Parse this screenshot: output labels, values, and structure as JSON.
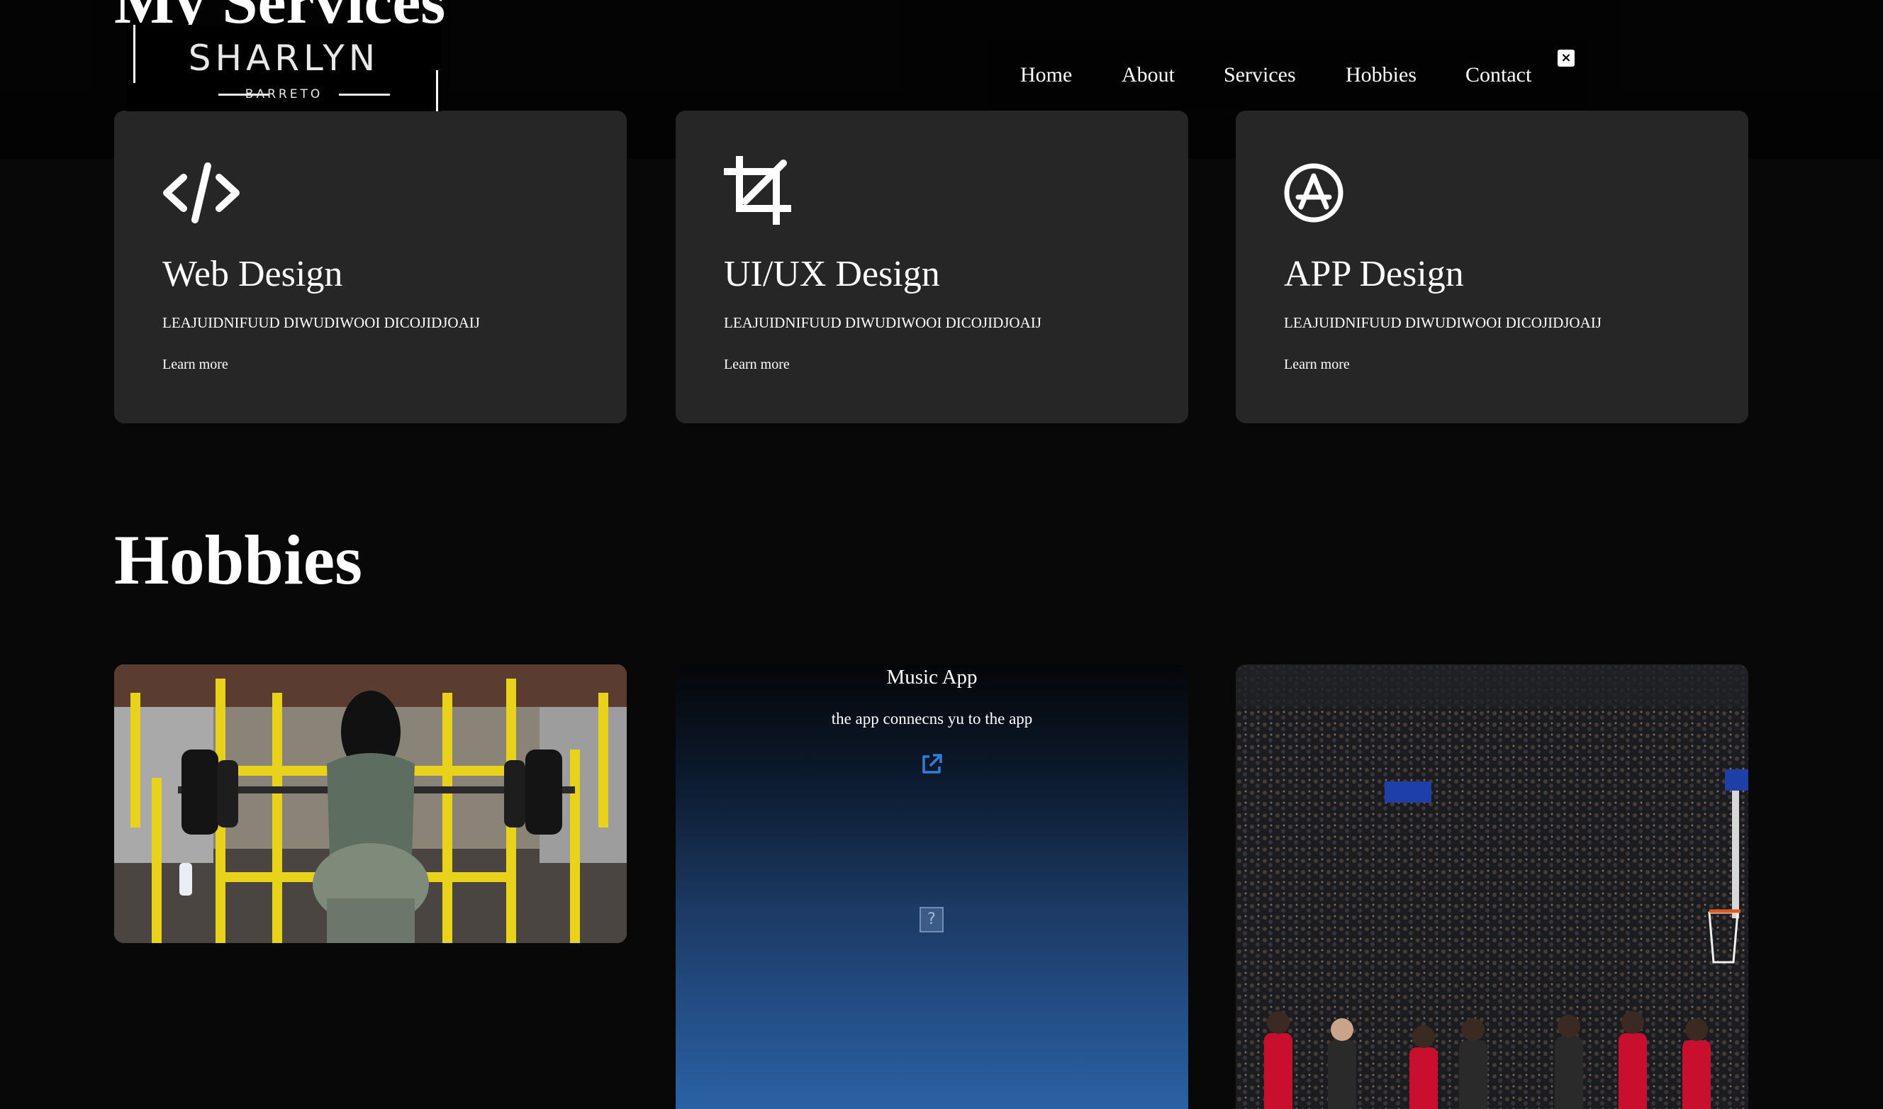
{
  "header": {
    "logo_name": "SHARLYN",
    "logo_sub": "BARRETO",
    "nav": [
      "Home",
      "About",
      "Services",
      "Hobbies",
      "Contact"
    ],
    "close_label": "×"
  },
  "services": {
    "heading": "My Services",
    "cards": [
      {
        "title": "Web Design",
        "desc": "LEAJUIDNIFUUD DIWUDIWOOI DICOJIDJOAIJ",
        "link": "Learn more",
        "icon": "code-icon"
      },
      {
        "title": "UI/UX Design",
        "desc": "LEAJUIDNIFUUD DIWUDIWOOI DICOJIDJOAIJ",
        "link": "Learn more",
        "icon": "crop-icon"
      },
      {
        "title": "APP Design",
        "desc": "LEAJUIDNIFUUD DIWUDIWOOI DICOJIDJOAIJ",
        "link": "Learn more",
        "icon": "app-store-icon"
      }
    ]
  },
  "hobbies": {
    "heading": "Hobbies",
    "music": {
      "title": "Music App",
      "desc": "the app connecns yu to the app",
      "link_icon": "external-link-icon",
      "image_icon": "broken-image-icon",
      "broken_image_glyph": "?"
    },
    "images": [
      "gym-photo",
      "basketball-arena-photo"
    ]
  },
  "colors": {
    "background": "#080808",
    "card": "#262626",
    "accent_link": "#2f7fd8",
    "gym_yellow": "#e8d21a",
    "jersey_red": "#c8102e"
  }
}
